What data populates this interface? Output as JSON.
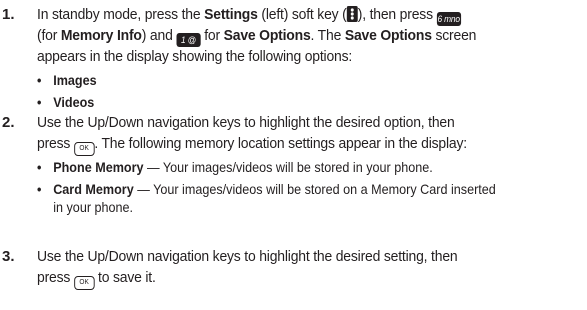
{
  "steps": [
    {
      "number": "1.",
      "lines": [
        [
          "In standby mode, press the ",
          {
            "b": "Settings"
          },
          " (left) soft key (",
          {
            "icon": "softkey"
          },
          "), then press ",
          {
            "icon": "key6"
          }
        ],
        [
          "(for ",
          {
            "b": "Memory Info"
          },
          ") and ",
          {
            "icon": "key1"
          },
          " for ",
          {
            "b": "Save Options"
          },
          ". The ",
          {
            "b": "Save Options"
          },
          " screen"
        ],
        [
          "appears in the display showing the following options:"
        ]
      ],
      "bullets": [
        "Images",
        "Videos"
      ]
    },
    {
      "number": "2.",
      "lines": [
        [
          "Use the Up/Down navigation keys to highlight the desired option, then"
        ],
        [
          "press ",
          {
            "icon": "ok"
          },
          ". The following memory location settings appear in the display:"
        ]
      ],
      "sub_items": [
        {
          "term": "Phone Memory",
          "text": " — Your images/videos will be stored in your phone."
        },
        {
          "term": "Card Memory",
          "text": " — Your images/videos will be stored on a Memory Card inserted",
          "cont": "in your phone."
        }
      ]
    },
    {
      "number": "3.",
      "lines": [
        [
          "Use the Up/Down navigation keys to highlight the desired setting, then"
        ],
        [
          "press ",
          {
            "icon": "ok"
          },
          " to save it."
        ]
      ]
    }
  ],
  "key_labels": {
    "key6": "6 mno",
    "key1": "1 @",
    "ok": "OK"
  }
}
